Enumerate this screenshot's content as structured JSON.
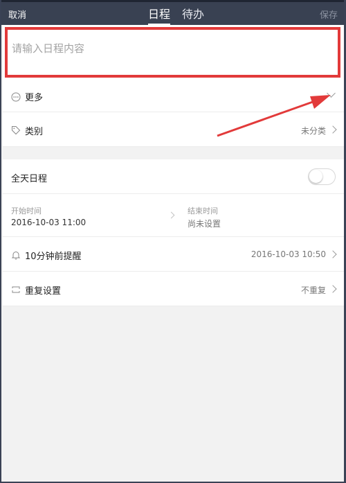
{
  "header": {
    "cancel_label": "取消",
    "save_label": "保存",
    "tabs": [
      {
        "label": "日程",
        "active": true
      },
      {
        "label": "待办",
        "active": false
      }
    ]
  },
  "content_input": {
    "placeholder": "请输入日程内容",
    "value": ""
  },
  "more_row": {
    "label": "更多",
    "icon": "ellipsis-circle-icon",
    "expanded": false
  },
  "category_row": {
    "label": "类别",
    "value": "未分类",
    "icon": "tag-icon"
  },
  "all_day_row": {
    "label": "全天日程",
    "toggle_on": false
  },
  "time_row": {
    "start_caption": "开始时间",
    "start_value": "2016-10-03 11:00",
    "end_caption": "结束时间",
    "end_value": "尚未设置"
  },
  "reminder_row": {
    "label": "10分钟前提醒",
    "value": "2016-10-03 10:50",
    "icon": "bell-icon"
  },
  "repeat_row": {
    "label": "重复设置",
    "value": "不重复",
    "icon": "repeat-icon"
  },
  "colors": {
    "header_bg": "#394152",
    "highlight_border": "#e23a3a",
    "annotation_arrow": "#e23a3a"
  }
}
